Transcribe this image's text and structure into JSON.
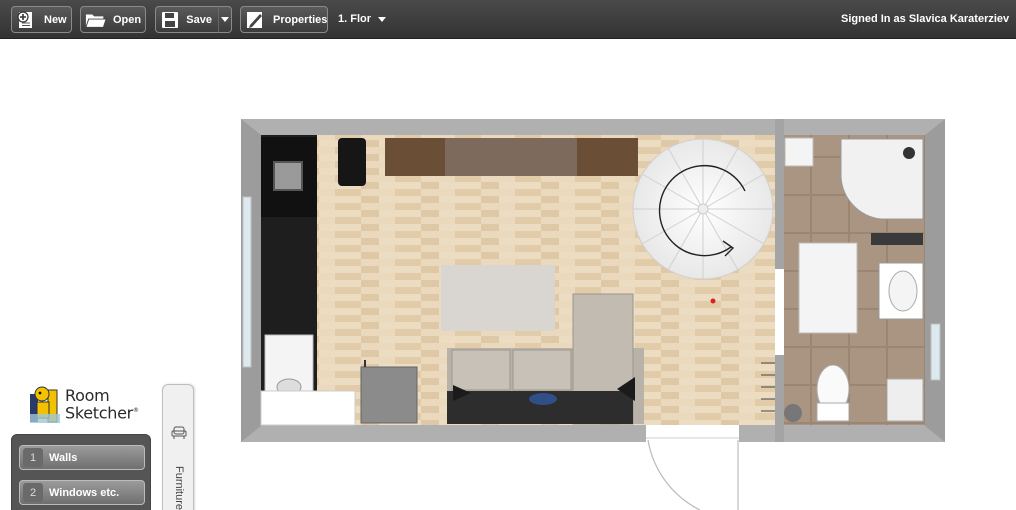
{
  "toolbar": {
    "new_label": "New",
    "open_label": "Open",
    "save_label": "Save",
    "properties_label": "Properties",
    "floor_label": "1. Flor",
    "signed_in": "Signed In as Slavica Karaterziev"
  },
  "logo": {
    "line1": "Room",
    "line2": "Sketcher",
    "mark": "®"
  },
  "panel": {
    "items": [
      {
        "num": "1",
        "label": "Walls"
      },
      {
        "num": "2",
        "label": "Windows etc."
      }
    ]
  },
  "furniture_tab": {
    "label": "Furniture",
    "icon": "armchair-icon"
  },
  "colors": {
    "toolbar_bg": "#3a3a3a",
    "wall": "#aaaaaa",
    "wood_floor": "#e6d3b6",
    "tile_floor": "#a89480",
    "sofa": "#bdb6ac"
  }
}
